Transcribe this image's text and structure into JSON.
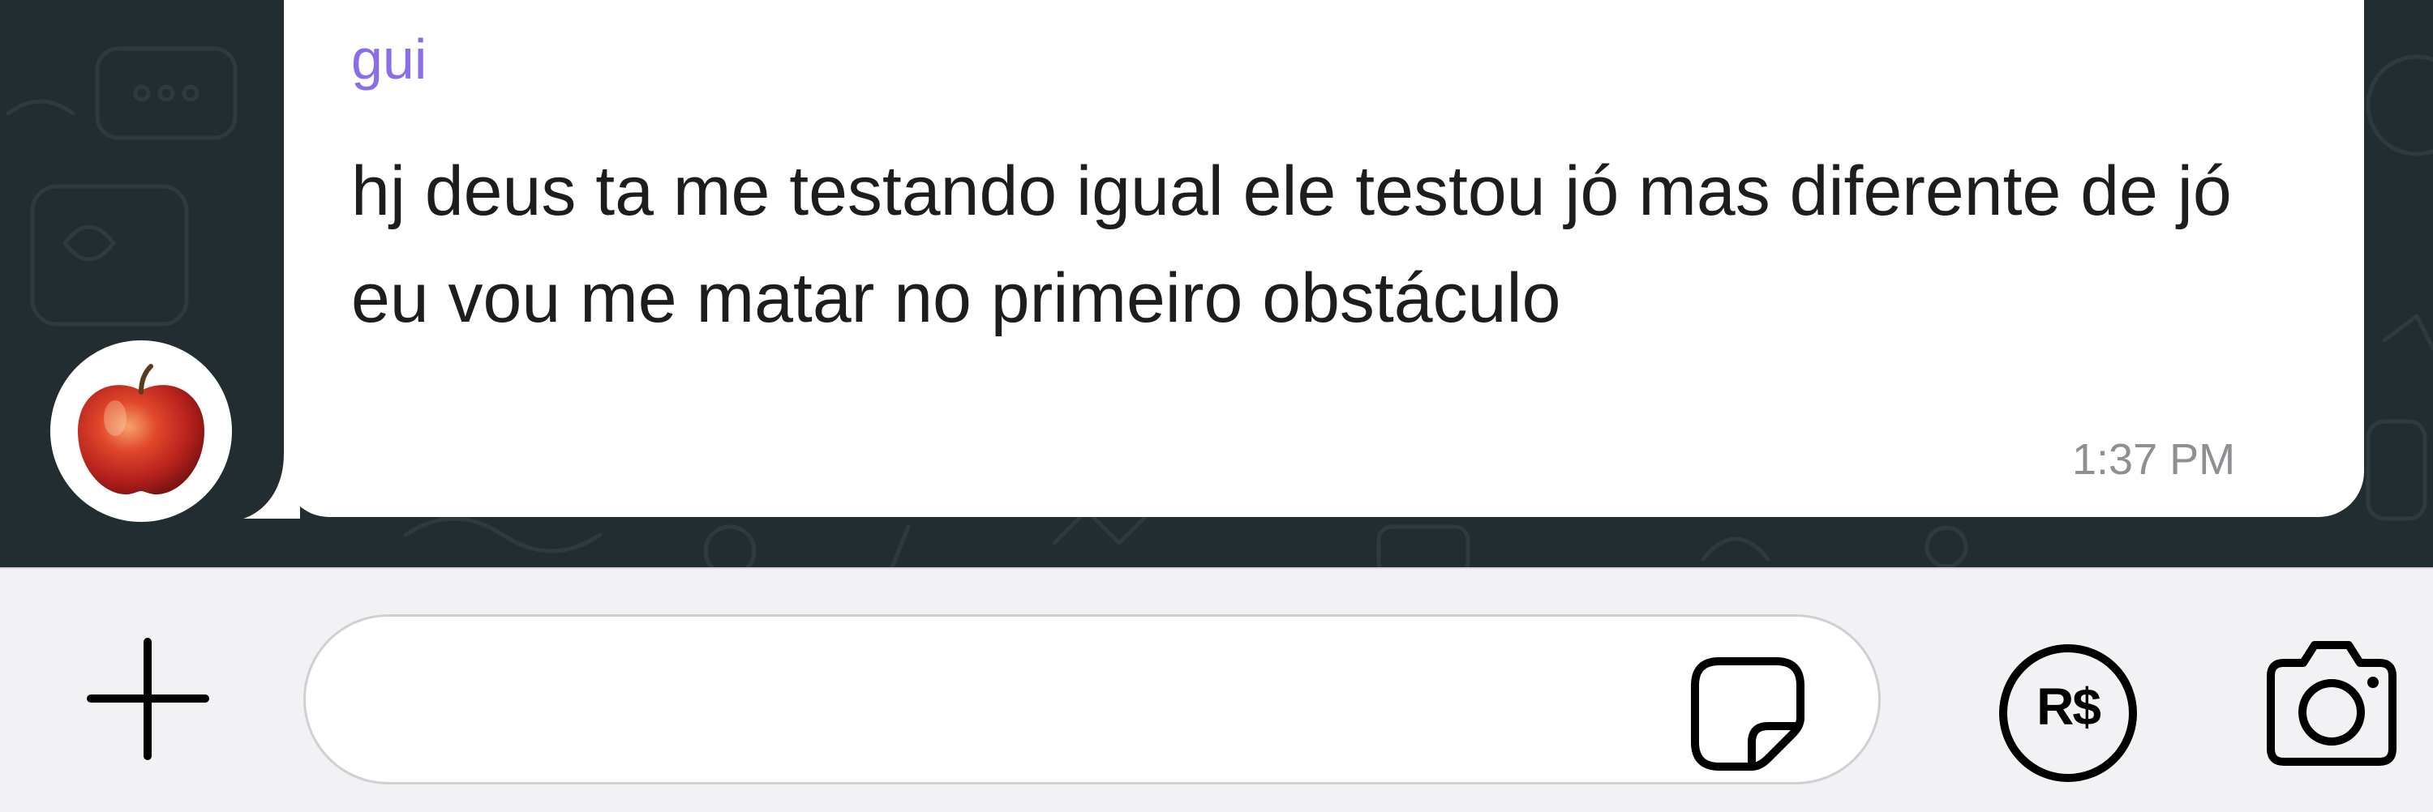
{
  "message": {
    "sender": "gui",
    "text": "hj deus ta me testando igual ele testou jó mas diferente de jó eu vou me matar no primeiro obstáculo",
    "time": "1:37 PM",
    "avatar_icon": "apple-avatar"
  },
  "composer": {
    "input_value": "",
    "plus_icon": "plus-icon",
    "sticker_icon": "sticker-icon",
    "payment_icon": "pix-payment-icon",
    "payment_label": "R$",
    "camera_icon": "camera-icon"
  },
  "colors": {
    "chat_background": "#222d31",
    "bubble": "#ffffff",
    "sender_name": "#8a6ee8",
    "timestamp": "#8e8e93",
    "composer_background": "#f2f2f4"
  }
}
